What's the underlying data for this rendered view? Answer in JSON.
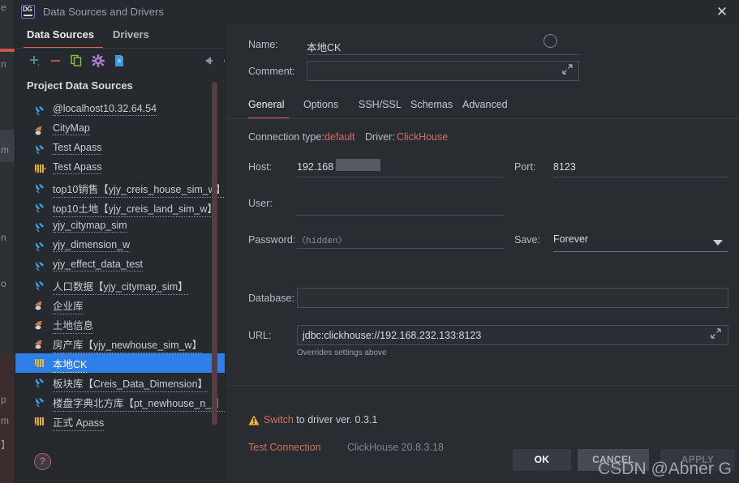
{
  "window": {
    "title": "Data Sources and Drivers",
    "app_icon": "datagrip-logo-icon",
    "close_label": "✕"
  },
  "sidebar": {
    "tabs": [
      {
        "label": "Data Sources",
        "selected": true
      },
      {
        "label": "Drivers",
        "selected": false
      }
    ],
    "toolbar": [
      {
        "name": "add-icon",
        "glyph": "+",
        "color": "#4b9e8e"
      },
      {
        "name": "remove-icon",
        "glyph": "−",
        "color": "#c4605c"
      },
      {
        "name": "copy-icon",
        "glyph": "❐",
        "color": "#8fbf4f"
      },
      {
        "name": "settings-gear-icon",
        "glyph": "⚙",
        "color": "#b07fd6"
      },
      {
        "name": "import-file-icon",
        "glyph": "⬛",
        "color": "#3a9ae0"
      },
      {
        "name": "back-arrow-icon",
        "glyph": "←",
        "color": "#8b9097"
      },
      {
        "name": "forward-arrow-icon",
        "glyph": "→",
        "color": "#8b9097"
      }
    ],
    "group_title": "Project Data Sources",
    "items": [
      {
        "label": "@localhost10.32.64.54",
        "icon": "db-generic-icon",
        "selected": false
      },
      {
        "label": "CityMap",
        "icon": "mysql-dolphin-icon",
        "selected": false
      },
      {
        "label": "Test Apass",
        "icon": "db-generic-icon",
        "selected": false
      },
      {
        "label": "Test Apass",
        "icon": "clickhouse-icon",
        "selected": false
      },
      {
        "label": "top10销售【yjy_creis_house_sim_w】",
        "icon": "db-generic-icon",
        "selected": false
      },
      {
        "label": "top10土地【yjy_creis_land_sim_w】",
        "icon": "db-generic-icon",
        "selected": false
      },
      {
        "label": "yjy_citymap_sim",
        "icon": "db-generic-icon",
        "selected": false
      },
      {
        "label": "yjy_dimension_w",
        "icon": "db-generic-icon",
        "selected": false
      },
      {
        "label": "yjy_effect_data_test",
        "icon": "db-generic-icon",
        "selected": false
      },
      {
        "label": "人口数据【yjy_citymap_sim】",
        "icon": "db-generic-icon",
        "selected": false
      },
      {
        "label": "企业库",
        "icon": "mysql-dolphin-icon",
        "selected": false
      },
      {
        "label": "土地信息",
        "icon": "mysql-dolphin-icon",
        "selected": false
      },
      {
        "label": "房产库【yjy_newhouse_sim_w】",
        "icon": "mysql-dolphin-icon",
        "selected": false
      },
      {
        "label": "本地CK",
        "icon": "clickhouse-icon",
        "selected": true
      },
      {
        "label": "板块库【Creis_Data_Dimension】",
        "icon": "db-generic-icon",
        "selected": false
      },
      {
        "label": "楼盘字典北方库【pt_newhouse_n_r】",
        "icon": "db-generic-icon",
        "selected": false
      },
      {
        "label": "正式 Apass",
        "icon": "clickhouse-icon",
        "selected": false
      }
    ],
    "help_label": "?"
  },
  "form": {
    "name_label": "Name:",
    "name_value": "本地CK",
    "name_indicator_icon": "color-circle-icon",
    "comment_label": "Comment:",
    "comment_value": "",
    "comment_expand_icon": "expand-editor-icon",
    "tabs": [
      {
        "label": "General",
        "active": true
      },
      {
        "label": "Options",
        "active": false
      },
      {
        "label": "SSH/SSL",
        "active": false
      },
      {
        "label": "Schemas",
        "active": false
      },
      {
        "label": "Advanced",
        "active": false
      }
    ],
    "connection_type_label": "Connection type:",
    "connection_type_value": "default",
    "driver_label": "Driver:",
    "driver_value": "ClickHouse",
    "host_label": "Host:",
    "host_value": "192.168",
    "host_redacted": true,
    "port_label": "Port:",
    "port_value": "8123",
    "user_label": "User:",
    "user_value": "",
    "password_label": "Password:",
    "password_placeholder": "〈hidden〉",
    "save_label": "Save:",
    "save_value": "Forever",
    "save_dropdown_icon": "chevron-down-icon",
    "database_label": "Database:",
    "database_value": "",
    "url_label": "URL:",
    "url_value": "jdbc:clickhouse://192.168.232.133:8123",
    "url_expand_icon": "expand-editor-icon",
    "url_hint": "Overrides settings above"
  },
  "status": {
    "warning_icon": "warning-triangle-icon",
    "switch_driver_link": "Switch",
    "switch_driver_rest": " to driver ver. 0.3.1",
    "test_connection_label": "Test Connection",
    "server_version": "ClickHouse 20.8.3.18"
  },
  "footer": {
    "ok_label": "OK",
    "cancel_label": "CANCEL",
    "apply_label": "APPLY"
  },
  "watermark": "CSDN @Abner G",
  "background_window_fragments": [
    "e",
    "n",
    "m",
    "n",
    "o",
    "p",
    "m",
    "】"
  ],
  "colors": {
    "accent_orange": "#d2705f",
    "selection_blue": "#2f7fe8",
    "dialog_bg": "#26292d",
    "content_bg": "#292c31",
    "scrollbar": "#573c40"
  }
}
